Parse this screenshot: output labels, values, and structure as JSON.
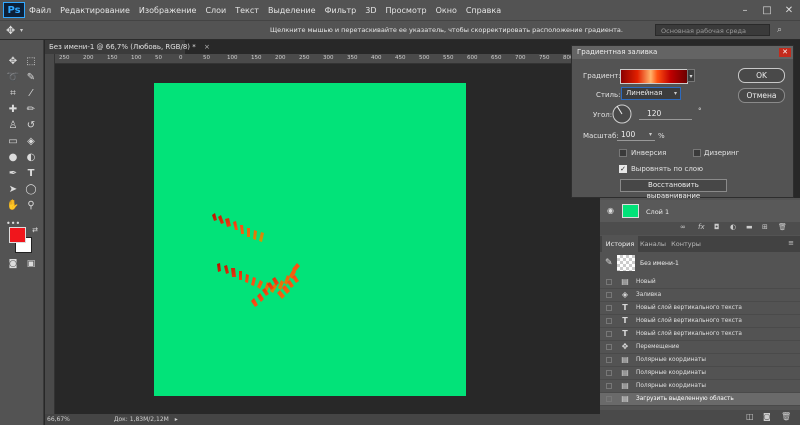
{
  "menubar": {
    "logo": "Ps",
    "items": [
      "Файл",
      "Редактирование",
      "Изображение",
      "Слои",
      "Текст",
      "Выделение",
      "Фильтр",
      "3D",
      "Просмотр",
      "Окно",
      "Справка"
    ]
  },
  "optionsbar": {
    "hint": "Щелкните мышью и перетаскивайте ее указатель, чтобы скорректировать расположение градиента.",
    "workspace": "Основная рабочая среда"
  },
  "document": {
    "tab_title": "Без имени-1 @ 66,7% (Любовь, RGB/8) *",
    "canvas_color": "#02e379",
    "ruler_ticks": [
      "250",
      "200",
      "150",
      "100",
      "50",
      "0",
      "50",
      "100",
      "150",
      "200",
      "250",
      "300",
      "350",
      "400",
      "450",
      "500",
      "550",
      "600",
      "650",
      "700",
      "750",
      "800",
      "850"
    ]
  },
  "statusbar": {
    "zoom": "66,67%",
    "doc_info": "Док: 1,83M/2,12M"
  },
  "dialog": {
    "title": "Градиентная заливка",
    "gradient_label": "Градиент:",
    "style_label": "Стиль:",
    "style_value": "Линейная",
    "angle_label": "Угол:",
    "angle_value": "120",
    "angle_unit": "°",
    "scale_label": "Масштаб:",
    "scale_value": "100",
    "scale_unit": "%",
    "reverse_label": "Инверсия",
    "dither_label": "Дизеринг",
    "align_label": "Выровнять по слою",
    "reset_button": "Восстановить выравнивание",
    "ok_button": "OK",
    "cancel_button": "Отмена",
    "reverse_checked": false,
    "dither_checked": false,
    "align_checked": true
  },
  "layers": {
    "layer_name": "Слой 1",
    "layer_color": "#02e379"
  },
  "panels": {
    "tabs": [
      "История",
      "Каналы",
      "Контуры"
    ],
    "active_tab": "История",
    "snapshot": "Без имени-1",
    "history": [
      {
        "label": "Новый",
        "icon": "document-icon"
      },
      {
        "label": "Заливка",
        "icon": "paint-bucket-icon"
      },
      {
        "label": "Новый слой вертикального текста",
        "icon": "text-icon"
      },
      {
        "label": "Новый слой вертикального текста",
        "icon": "text-icon"
      },
      {
        "label": "Новый слой вертикального текста",
        "icon": "text-icon"
      },
      {
        "label": "Перемещение",
        "icon": "move-icon"
      },
      {
        "label": "Полярные координаты",
        "icon": "document-icon"
      },
      {
        "label": "Полярные координаты",
        "icon": "document-icon"
      },
      {
        "label": "Полярные координаты",
        "icon": "document-icon"
      },
      {
        "label": "Загрузить выделенную область",
        "icon": "document-icon"
      }
    ]
  }
}
